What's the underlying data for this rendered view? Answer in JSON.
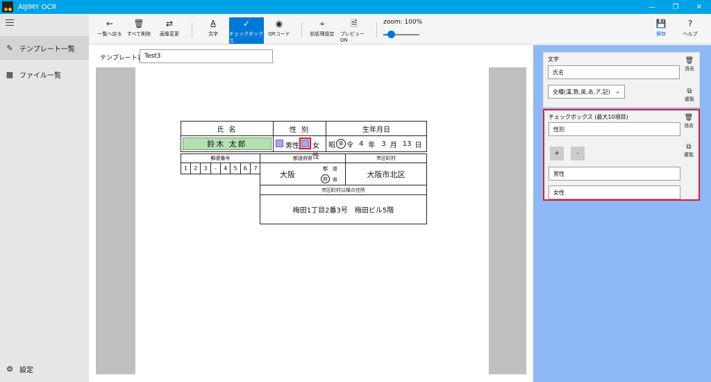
{
  "app": {
    "title": "AIJIMY OCR"
  },
  "sidebar": {
    "items": [
      {
        "label": "テンプレート一覧",
        "icon": "template-list-icon"
      },
      {
        "label": "ファイル一覧",
        "icon": "file-list-icon"
      }
    ],
    "settings_label": "設定"
  },
  "toolbar": {
    "back_label": "一覧へ戻る",
    "delete_all_label": "すべて削除",
    "change_image_label": "画像変更",
    "text_label": "文字",
    "checkbox_label": "チェックボックス",
    "qrcode_label": "QRコード",
    "preprocess_label": "前処理設定",
    "preview_label": "プレビューON",
    "zoom_label": "zoom:  100%",
    "zoom_value": 0.15,
    "save_label": "保存",
    "help_label": "ヘルプ"
  },
  "template": {
    "name_label": "テンプレート名：",
    "name_value": "Test3"
  },
  "form": {
    "h_name": "氏 名",
    "h_gender": "性 別",
    "h_dob": "生年月日",
    "name_value": "鈴木 太郎",
    "male": "男性",
    "female": "女性",
    "era_showa": "昭",
    "era_heisei": "平",
    "era_reiwa": "令",
    "dob_year": "4",
    "dob_year_unit": "年",
    "dob_month": "3",
    "dob_month_unit": "月",
    "dob_day": "13",
    "dob_day_unit": "日",
    "h_postal": "郵便番号",
    "h_pref": "都道府県",
    "h_city": "市区町村",
    "postal_digits": [
      "1",
      "2",
      "3",
      "-",
      "4",
      "5",
      "6",
      "7"
    ],
    "pref_value": "大阪",
    "pref_to": "都",
    "pref_do": "道",
    "pref_fu": "府",
    "pref_ken": "県",
    "city_value": "大阪市北区",
    "h_address": "市区町村以降の住所",
    "address_value": "梅田1丁目2番3号　梅田ビル5階"
  },
  "panel": {
    "text_card": {
      "title": "文字",
      "field_value": "氏名",
      "type_select": "全種(漢,数,英,あ,ア,記)",
      "delete_label": "消去",
      "copy_label": "複製"
    },
    "checkbox_card": {
      "title": "チェックボックス (最大10項目)",
      "field_value": "性別",
      "plus_label": "+",
      "minus_label": "-",
      "options": [
        "男性",
        "女性"
      ],
      "delete_label": "消去",
      "copy_label": "複製"
    }
  }
}
